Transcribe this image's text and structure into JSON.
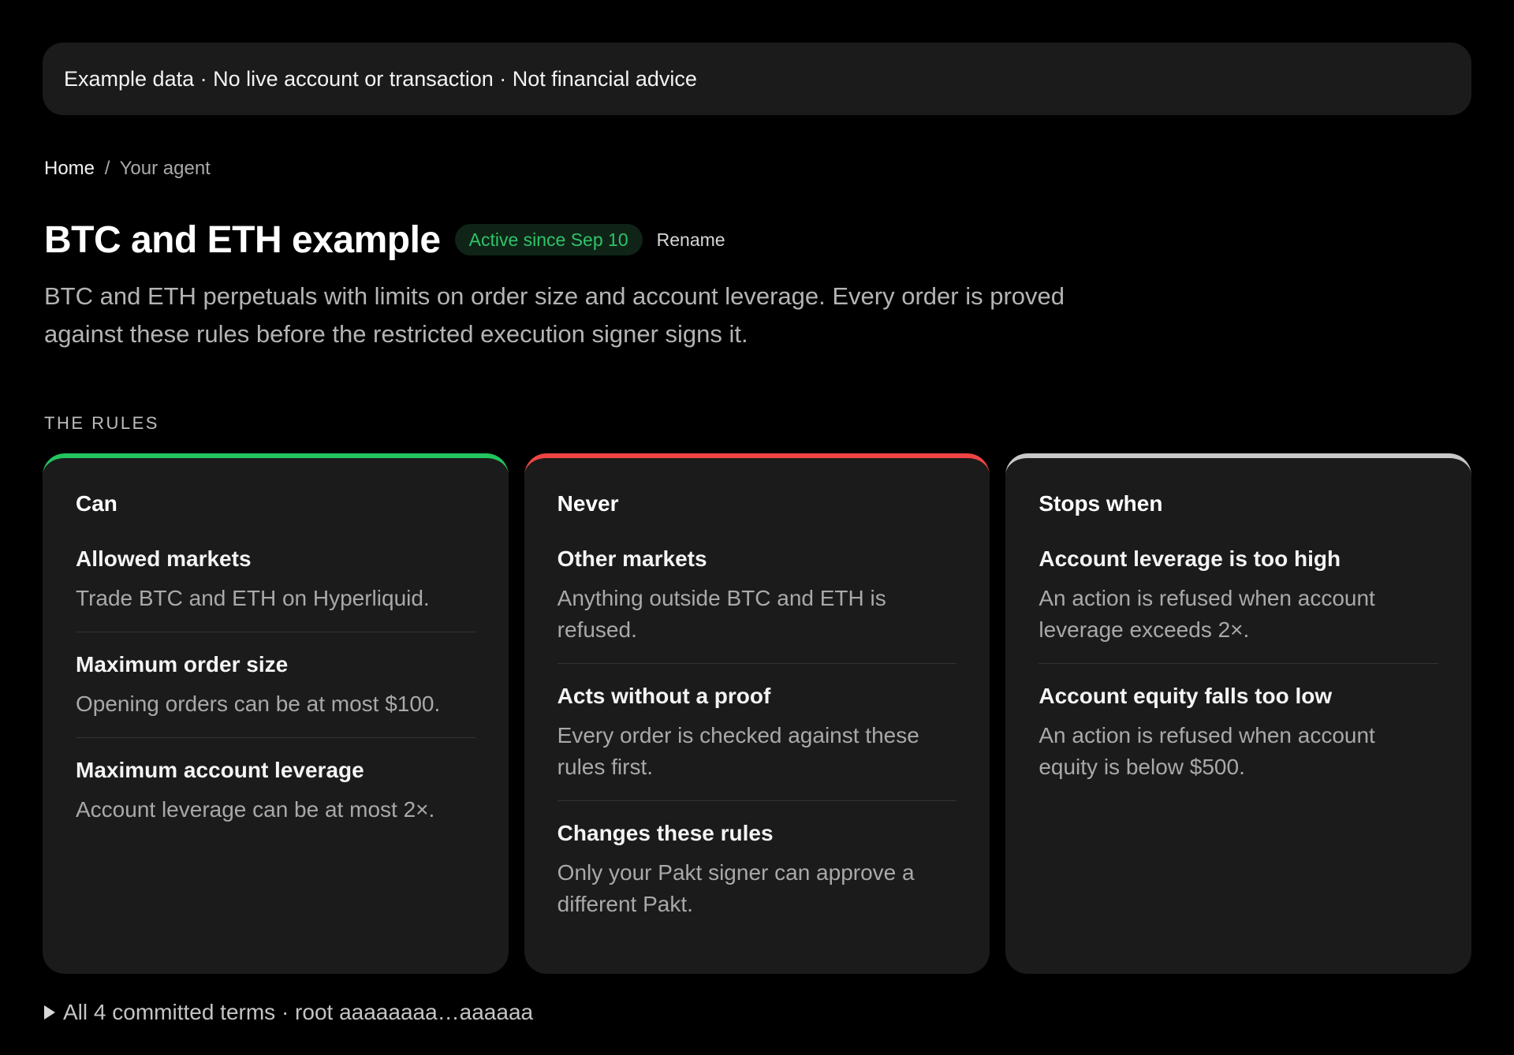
{
  "notice": {
    "text": "Example data · No live account or transaction · Not financial advice"
  },
  "breadcrumb": {
    "home": "Home",
    "separator": "/",
    "current": "Your agent"
  },
  "header": {
    "title": "BTC and ETH example",
    "status": "Active since Sep 10",
    "rename_label": "Rename",
    "description": "BTC and ETH perpetuals with limits on order size and account leverage. Every order is proved against these rules before the restricted execution signer signs it."
  },
  "rules_section": {
    "label": "THE RULES",
    "cards": [
      {
        "title": "Can",
        "accent": "#22c55e",
        "rules": [
          {
            "title": "Allowed markets",
            "desc": "Trade BTC and ETH on Hyperliquid."
          },
          {
            "title": "Maximum order size",
            "desc": "Opening orders can be at most $100."
          },
          {
            "title": "Maximum account leverage",
            "desc": "Account leverage can be at most 2×."
          }
        ]
      },
      {
        "title": "Never",
        "accent": "#ef4444",
        "rules": [
          {
            "title": "Other markets",
            "desc": "Anything outside BTC and ETH is refused."
          },
          {
            "title": "Acts without a proof",
            "desc": "Every order is checked against these rules first."
          },
          {
            "title": "Changes these rules",
            "desc": "Only your Pakt signer can approve a different Pakt."
          }
        ]
      },
      {
        "title": "Stops when",
        "accent": "#c8c8c8",
        "rules": [
          {
            "title": "Account leverage is too high",
            "desc": "An action is refused when account leverage exceeds 2×."
          },
          {
            "title": "Account equity falls too low",
            "desc": "An action is refused when account equity is below $500."
          }
        ]
      }
    ]
  },
  "footer": {
    "summary": "All 4 committed terms · root aaaaaaaa…aaaaaa"
  }
}
